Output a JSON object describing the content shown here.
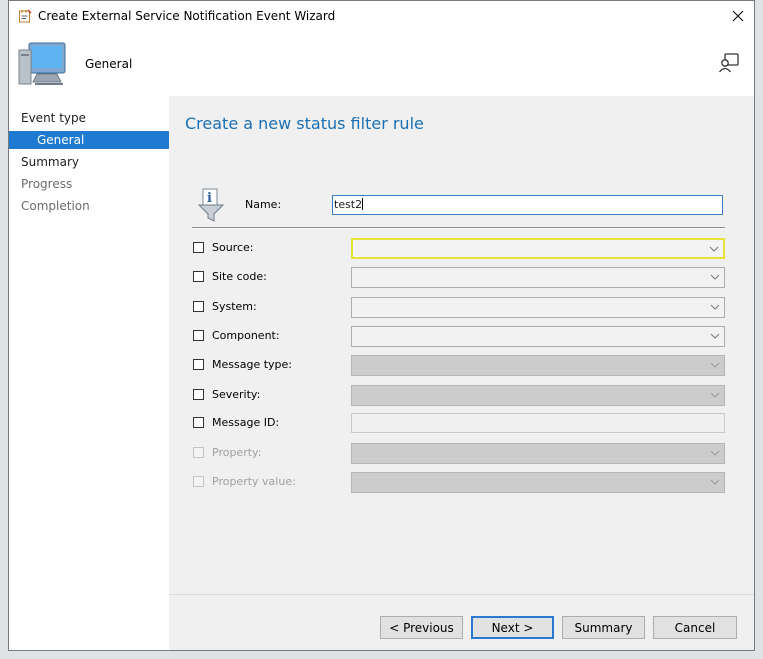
{
  "window": {
    "title": "Create External Service Notification Event Wizard"
  },
  "header": {
    "title": "General"
  },
  "sidebar": {
    "items": [
      {
        "label": "Event type",
        "state": "normal"
      },
      {
        "label": "General",
        "state": "selected"
      },
      {
        "label": "Summary",
        "state": "normal"
      },
      {
        "label": "Progress",
        "state": "disabled"
      },
      {
        "label": "Completion",
        "state": "disabled"
      }
    ]
  },
  "main": {
    "title": "Create a new status filter rule",
    "name_label": "Name:",
    "name_value": "test2",
    "criteria": [
      {
        "label": "Source:",
        "control": "combo",
        "value": "",
        "enabled": true,
        "checked": false
      },
      {
        "label": "Site code:",
        "control": "combo",
        "value": "",
        "enabled": true,
        "checked": false
      },
      {
        "label": "System:",
        "control": "combo",
        "value": "",
        "enabled": true,
        "checked": false
      },
      {
        "label": "Component:",
        "control": "combo",
        "value": "",
        "enabled": true,
        "checked": false
      },
      {
        "label": "Message type:",
        "control": "combo",
        "value": "",
        "enabled": false,
        "checked": false
      },
      {
        "label": "Severity:",
        "control": "combo",
        "value": "",
        "enabled": false,
        "checked": false
      },
      {
        "label": "Message ID:",
        "control": "text",
        "value": "",
        "enabled": false,
        "checked": false
      },
      {
        "label": "Property:",
        "control": "combo",
        "value": "",
        "enabled": false,
        "checked": false
      },
      {
        "label": "Property value:",
        "control": "combo",
        "value": "",
        "enabled": false,
        "checked": false
      }
    ]
  },
  "buttons": {
    "previous": "< Previous",
    "next": "Next >",
    "summary": "Summary",
    "cancel": "Cancel"
  },
  "colors": {
    "accent": "#1f7bd1",
    "title_blue": "#1b6fb5",
    "focus_highlight": "#e7e23a"
  }
}
